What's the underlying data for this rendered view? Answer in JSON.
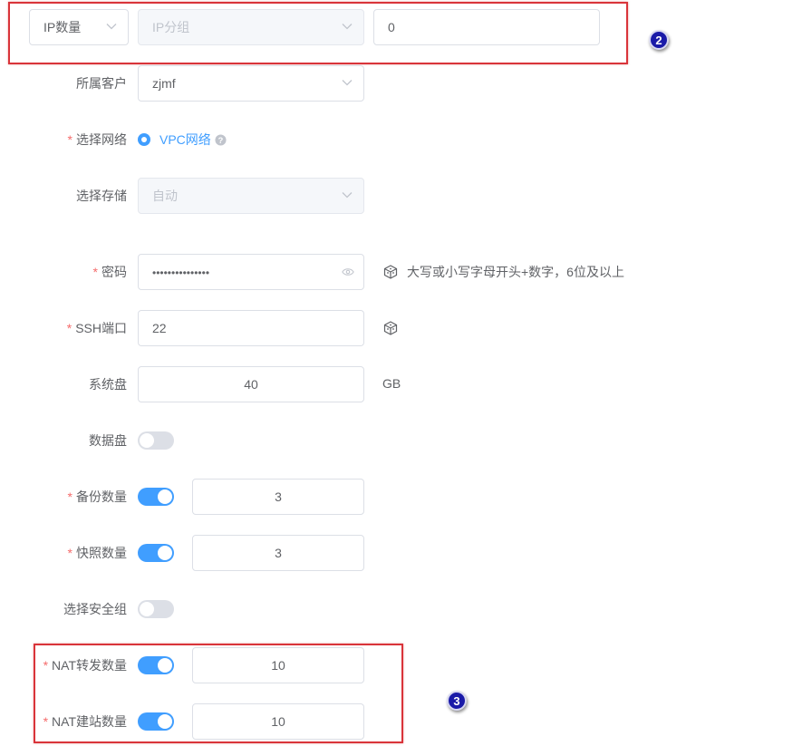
{
  "ip_row": {
    "type_select": "IP数量",
    "group_select_placeholder": "IP分组",
    "count_input": "0",
    "badge": "2"
  },
  "customer": {
    "label": "所属客户",
    "value": "zjmf"
  },
  "network": {
    "label": "选择网络",
    "option": "VPC网络"
  },
  "storage": {
    "label": "选择存储",
    "placeholder": "自动"
  },
  "password": {
    "label": "密码",
    "value": "•••••••••••••••",
    "hint": "大写或小写字母开头+数字，6位及以上"
  },
  "ssh": {
    "label": "SSH端口",
    "value": "22"
  },
  "system_disk": {
    "label": "系统盘",
    "value": "40",
    "unit": "GB"
  },
  "data_disk": {
    "label": "数据盘",
    "enabled": false
  },
  "backup": {
    "label": "备份数量",
    "enabled": true,
    "value": "3"
  },
  "snapshot": {
    "label": "快照数量",
    "enabled": true,
    "value": "3"
  },
  "security_group": {
    "label": "选择安全组",
    "enabled": false
  },
  "nat_forward": {
    "label": "NAT转发数量",
    "enabled": true,
    "value": "10"
  },
  "nat_site": {
    "label": "NAT建站数量",
    "enabled": true,
    "value": "10"
  },
  "nat_badge": "3",
  "colors": {
    "primary": "#409eff",
    "required": "#f56c6c",
    "annotation": "#d9343a",
    "badge": "#1a1aa8"
  }
}
